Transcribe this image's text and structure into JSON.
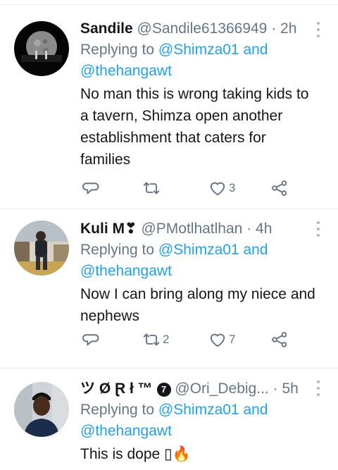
{
  "tweets": [
    {
      "name": "Sandile",
      "handle": "@Sandile61366949",
      "separator": "·",
      "time": "2h",
      "replying_prefix": "Replying to",
      "mention_1": "@Shimza01",
      "and_word": "and",
      "mention_2": "@thehangawt",
      "text_lines": [
        "No man this is wrong taking kids to",
        "a tavern, Shimza open another",
        "establishment that caters for",
        "families"
      ],
      "reply_count": "",
      "retweet_count": "",
      "like_count": "3"
    },
    {
      "name": "Kuli M",
      "name_emoji": "❣",
      "handle": "@PMotlhatlhan",
      "separator": "·",
      "time": "4h",
      "replying_prefix": "Replying to",
      "mention_1": "@Shimza01",
      "and_word": "and",
      "mention_2": "@thehangawt",
      "text_lines": [
        "Now I can bring along my niece and",
        "nephews"
      ],
      "reply_count": "",
      "retweet_count": "2",
      "like_count": "7"
    },
    {
      "name": "ツ Ø Ɽ ł ™",
      "name_badge": "7",
      "handle": "@Ori_Debig...",
      "separator": "·",
      "time": "5h",
      "replying_prefix": "Replying to",
      "mention_1": "@Shimza01",
      "and_word": "and",
      "mention_2": "@thehangawt",
      "text_start": "This is dope",
      "text_emoji_missing": "▯",
      "text_emoji_fire": "🔥"
    }
  ],
  "colors": {
    "link": "#1da1f2",
    "secondary": "#657786",
    "divider": "#e6ecf0",
    "text": "#14171a"
  },
  "icons": [
    "reply-icon",
    "retweet-icon",
    "like-icon",
    "share-icon",
    "more-icon"
  ]
}
